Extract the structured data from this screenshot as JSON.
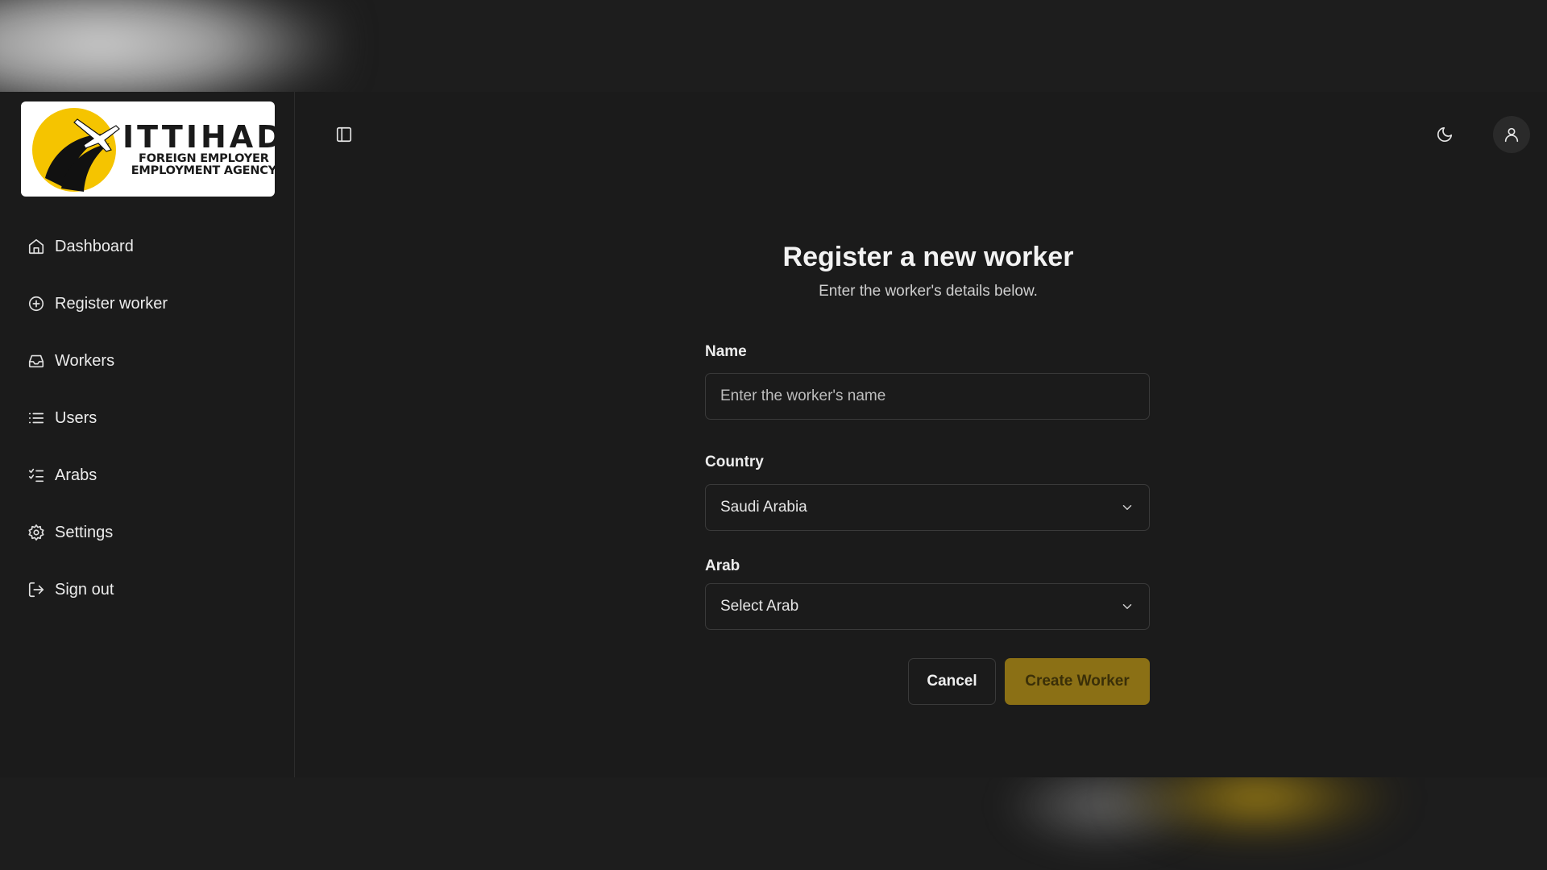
{
  "logo": {
    "title": "ITTIHAD",
    "subtitle_line1": "FOREIGN EMPLOYER",
    "subtitle_line2": "EMPLOYMENT AGENCY"
  },
  "sidebar": {
    "items": [
      {
        "label": "Dashboard",
        "icon": "home-icon"
      },
      {
        "label": "Register worker",
        "icon": "plus-circle-icon"
      },
      {
        "label": "Workers",
        "icon": "inbox-icon"
      },
      {
        "label": "Users",
        "icon": "list-icon"
      },
      {
        "label": "Arabs",
        "icon": "list-checks-icon"
      },
      {
        "label": "Settings",
        "icon": "gear-icon"
      },
      {
        "label": "Sign out",
        "icon": "sign-out-icon"
      }
    ]
  },
  "header": {
    "toggle_icon": "sidebar-toggle-icon",
    "theme_icon": "moon-icon",
    "user_icon": "user-icon"
  },
  "form": {
    "title": "Register a new worker",
    "subtitle": "Enter the worker's details below.",
    "name": {
      "label": "Name",
      "value": "",
      "placeholder": "Enter the worker's name"
    },
    "country": {
      "label": "Country",
      "value": "Saudi Arabia"
    },
    "arab": {
      "label": "Arab",
      "value": "Select Arab"
    },
    "cancel_label": "Cancel",
    "create_label": "Create Worker"
  },
  "colors": {
    "background": "#1b1b1b",
    "accent": "#8b7015",
    "text": "#ececec",
    "border": "#3a3a3a"
  }
}
